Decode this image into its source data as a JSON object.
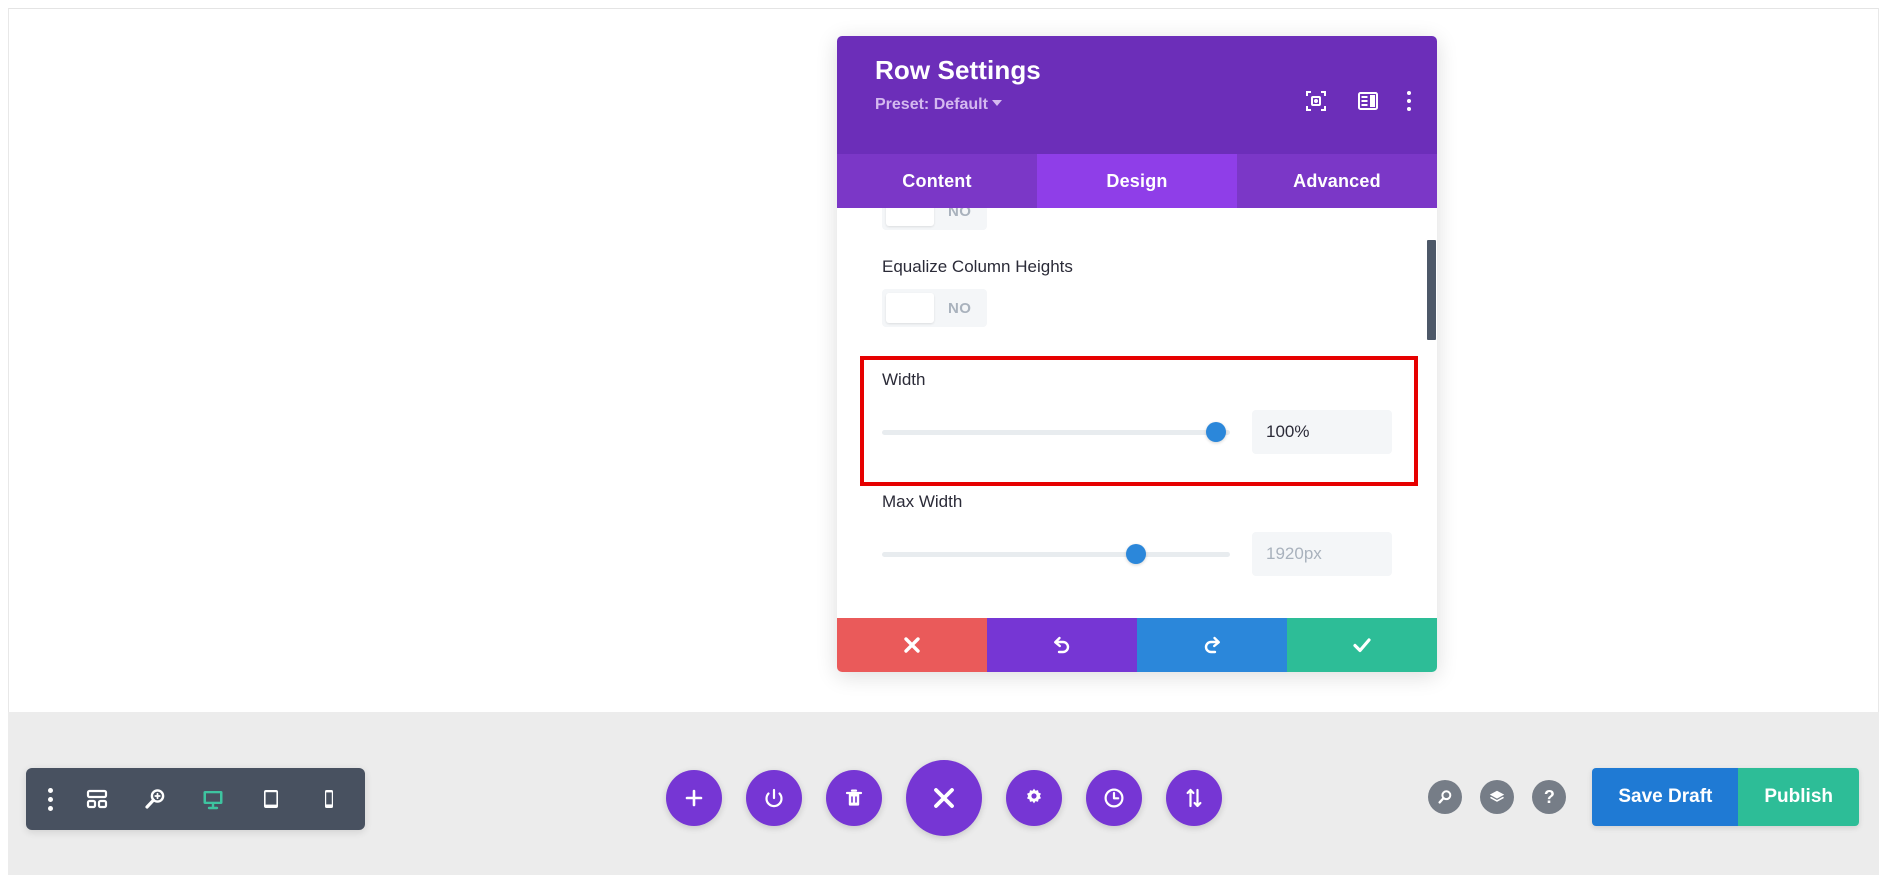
{
  "modal": {
    "title": "Row Settings",
    "preset_label": "Preset: Default",
    "header_icons": [
      {
        "name": "focus-icon"
      },
      {
        "name": "layout-panel-icon"
      },
      {
        "name": "more-options-icon"
      }
    ],
    "tabs": [
      {
        "label": "Content",
        "active": false
      },
      {
        "label": "Design",
        "active": true
      },
      {
        "label": "Advanced",
        "active": false
      }
    ],
    "fields": {
      "partial_toggle_value": "NO",
      "equalize_label": "Equalize Column Heights",
      "equalize_value": "NO",
      "width_label": "Width",
      "width_value": "100%",
      "width_slider_percent": 96,
      "max_width_label": "Max Width",
      "max_width_value": "1920px",
      "max_width_slider_percent": 73
    },
    "footer_buttons": [
      {
        "name": "cancel",
        "icon": "close-icon",
        "color": "#ea5a5a"
      },
      {
        "name": "undo",
        "icon": "undo-icon",
        "color": "#7636d4"
      },
      {
        "name": "redo",
        "icon": "redo-icon",
        "color": "#2b87da"
      },
      {
        "name": "save",
        "icon": "check-icon",
        "color": "#2dbd97"
      }
    ],
    "highlight_color": "#e60000"
  },
  "toolbar": {
    "left_items": [
      {
        "name": "more-options-icon"
      },
      {
        "name": "wireframe-icon"
      },
      {
        "name": "zoom-out-view-icon"
      },
      {
        "name": "desktop-icon",
        "active": true
      },
      {
        "name": "tablet-icon",
        "active": false
      },
      {
        "name": "phone-icon",
        "active": false
      }
    ],
    "center_items": [
      {
        "name": "add-icon"
      },
      {
        "name": "power-icon"
      },
      {
        "name": "trash-icon"
      },
      {
        "name": "close-builder-icon",
        "large": true
      },
      {
        "name": "settings-gear-icon"
      },
      {
        "name": "history-clock-icon"
      },
      {
        "name": "sort-arrows-icon"
      }
    ],
    "right_items": [
      {
        "name": "search-icon"
      },
      {
        "name": "layers-icon"
      },
      {
        "name": "help-icon",
        "glyph": "?"
      }
    ],
    "save_draft_label": "Save Draft",
    "publish_label": "Publish",
    "accent_blue": "#1f7ad4",
    "accent_green": "#2dbd97",
    "toolbar_dark": "#485160",
    "active_green": "#3ec4a0"
  }
}
